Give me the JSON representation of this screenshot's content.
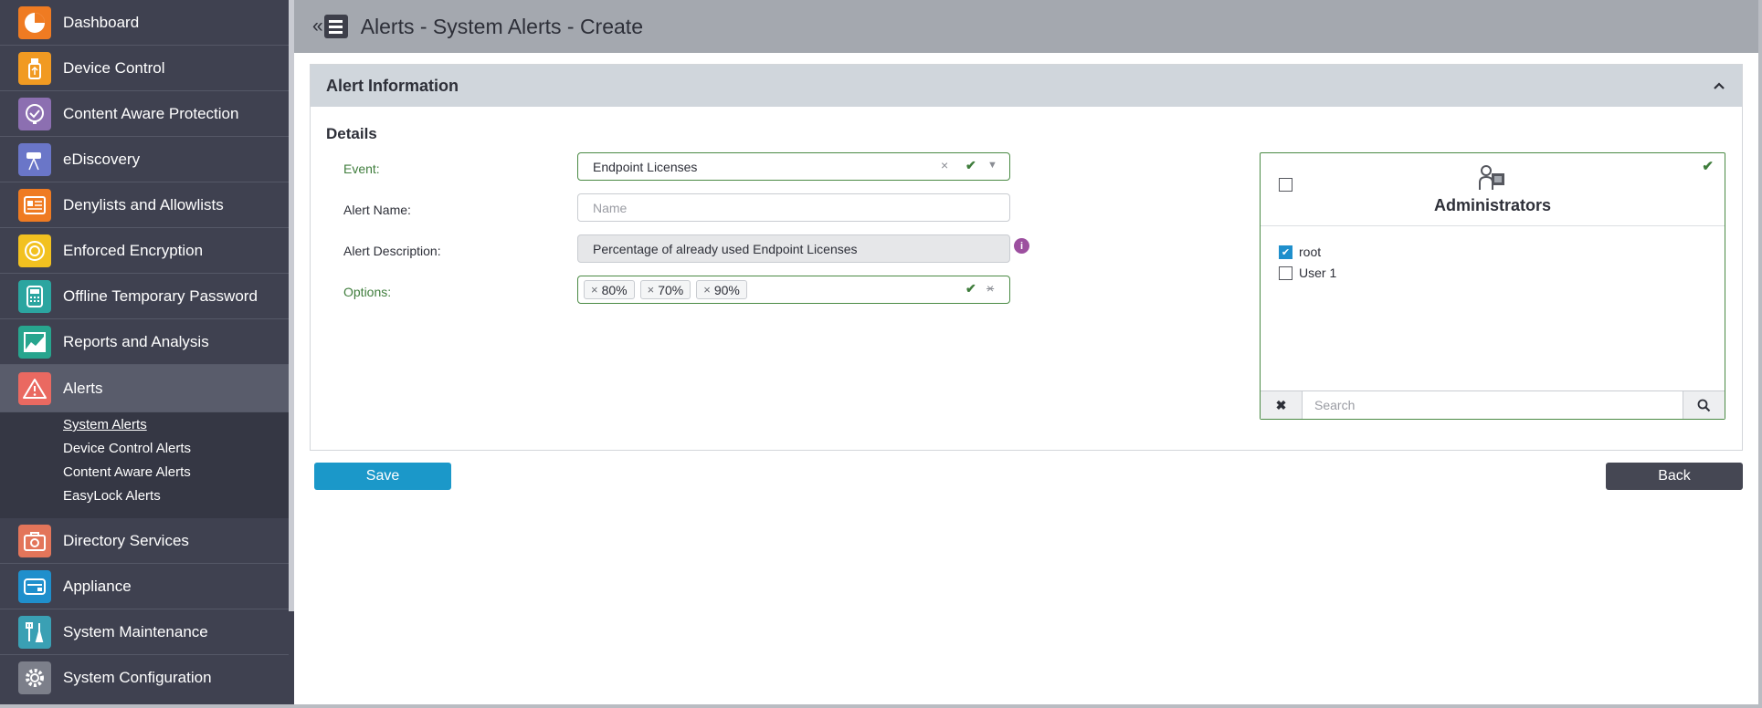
{
  "sidebar": {
    "items": [
      {
        "label": "Dashboard",
        "icon": "dashboard-icon",
        "color": "#ef7b22"
      },
      {
        "label": "Device Control",
        "icon": "usb-icon",
        "color": "#f19a22"
      },
      {
        "label": "Content Aware Protection",
        "icon": "content-protection-icon",
        "color": "#8c6fb1"
      },
      {
        "label": "eDiscovery",
        "icon": "telescope-icon",
        "color": "#6a76c8"
      },
      {
        "label": "Denylists and Allowlists",
        "icon": "list-icon",
        "color": "#ef7b22"
      },
      {
        "label": "Enforced Encryption",
        "icon": "encryption-icon",
        "color": "#f2c120"
      },
      {
        "label": "Offline Temporary Password",
        "icon": "password-icon",
        "color": "#2ba5a0"
      },
      {
        "label": "Reports and Analysis",
        "icon": "reports-icon",
        "color": "#27a58e"
      },
      {
        "label": "Alerts",
        "icon": "alert-icon",
        "color": "#ea6961"
      },
      {
        "label": "Directory Services",
        "icon": "directory-icon",
        "color": "#e3755a"
      },
      {
        "label": "Appliance",
        "icon": "appliance-icon",
        "color": "#1f8fcc"
      },
      {
        "label": "System Maintenance",
        "icon": "tools-icon",
        "color": "#3aa0b4"
      },
      {
        "label": "System Configuration",
        "icon": "gear-icon",
        "color": "#7c7f8a"
      }
    ],
    "alerts_sub": [
      "System Alerts",
      "Device Control Alerts",
      "Content Aware Alerts",
      "EasyLock Alerts"
    ]
  },
  "header": {
    "title": "Alerts - System Alerts - Create",
    "back_glyph": "«"
  },
  "panel": {
    "title": "Alert Information",
    "section": "Details"
  },
  "form": {
    "event_label": "Event:",
    "event_value": "Endpoint Licenses",
    "name_label": "Alert Name:",
    "name_placeholder": "Name",
    "description_label": "Alert Description:",
    "description_value": "Percentage of already used Endpoint Licenses",
    "options_label": "Options:",
    "options": [
      "80%",
      "70%",
      "90%"
    ]
  },
  "administrators": {
    "title": "Administrators",
    "users": [
      {
        "name": "root",
        "checked": true
      },
      {
        "name": "User 1",
        "checked": false
      }
    ],
    "search_placeholder": "Search"
  },
  "buttons": {
    "save": "Save",
    "back": "Back"
  }
}
